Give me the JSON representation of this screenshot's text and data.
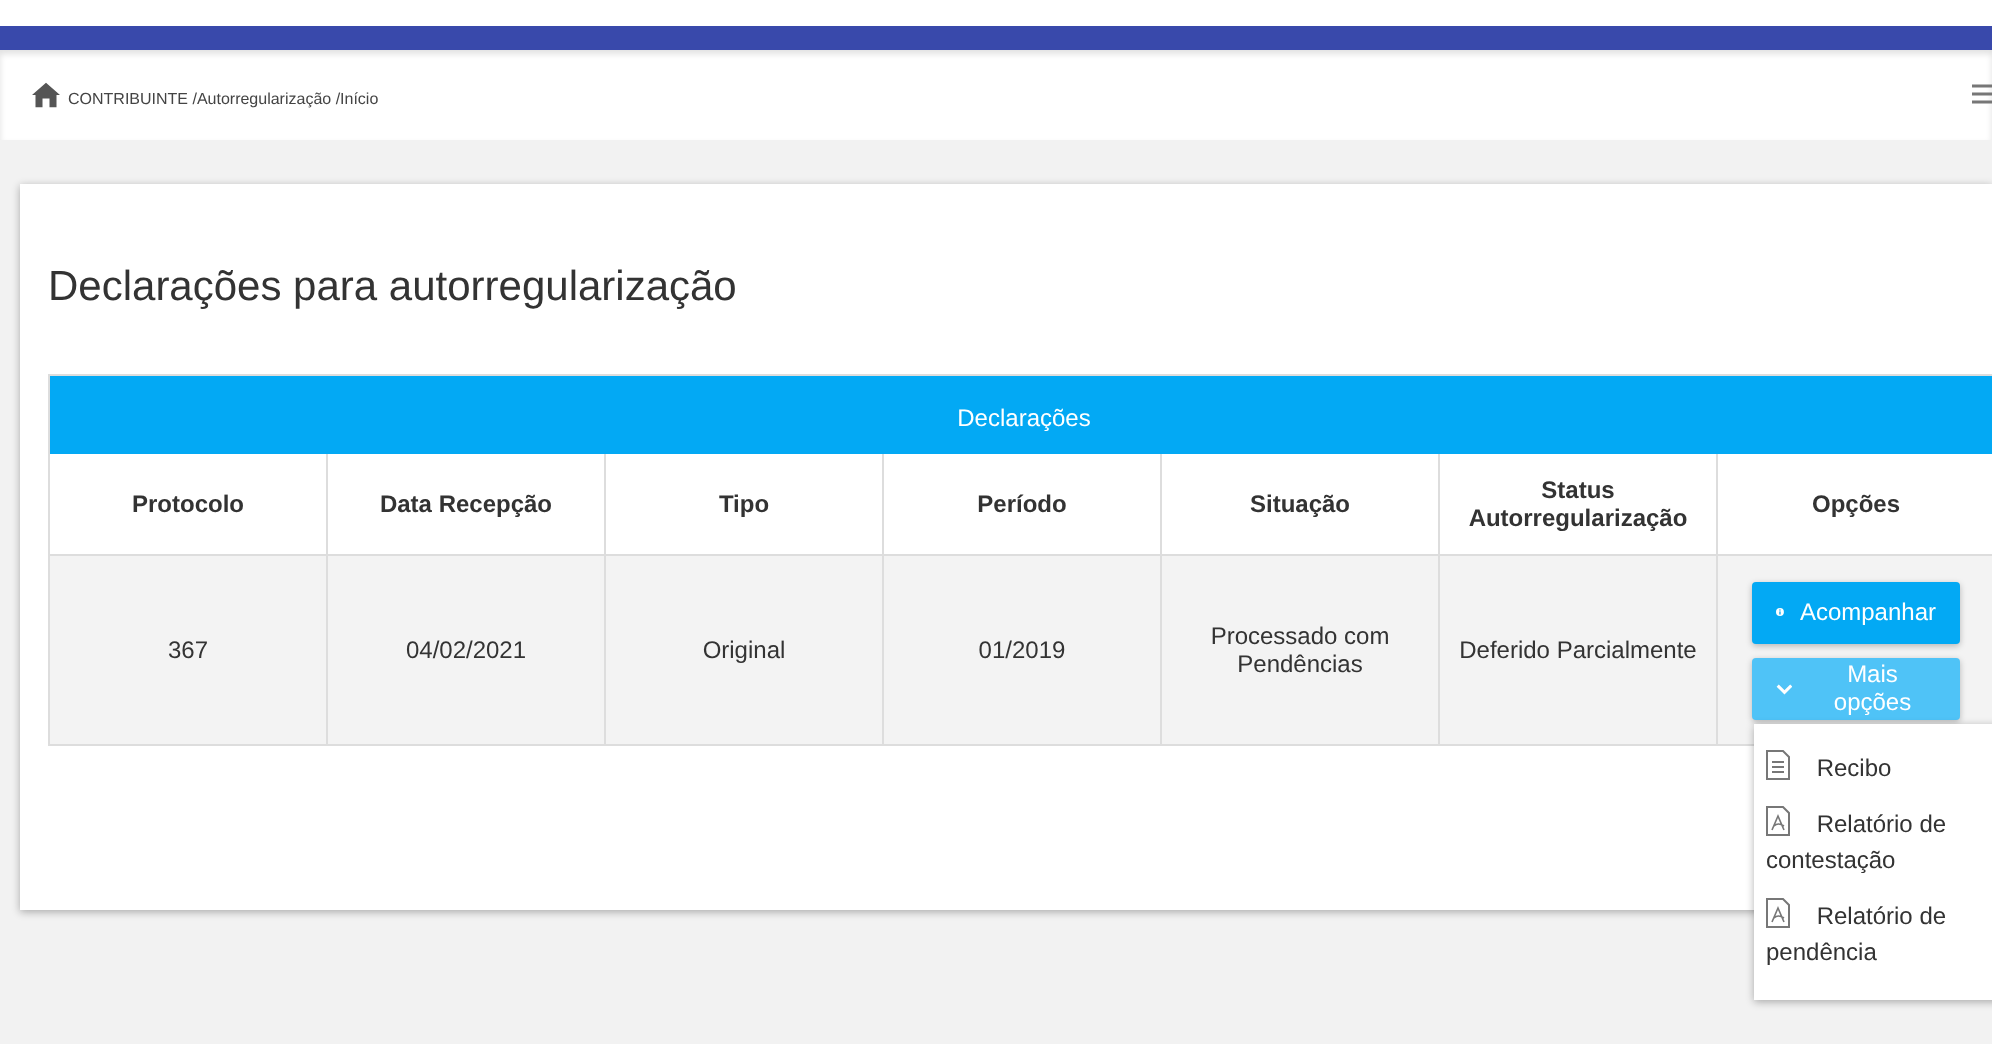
{
  "breadcrumb": "CONTRIBUINTE /Autorregularização /Início",
  "page_title": "Declarações para autorregularização",
  "table": {
    "caption": "Declarações",
    "columns": [
      "Protocolo",
      "Data Recepção",
      "Tipo",
      "Período",
      "Situação",
      "Status Autorregularização",
      "Opções"
    ],
    "rows": [
      {
        "cells": [
          "367",
          "04/02/2021",
          "Original",
          "01/2019",
          "Processado com Pendências",
          "Deferido Parcialmente"
        ],
        "actions": [
          {
            "kind": "info",
            "label": "Acompanhar"
          },
          {
            "kind": "more",
            "label": "Mais opções",
            "expanded": true
          }
        ]
      }
    ]
  },
  "menu": [
    {
      "kind": "doc",
      "label": "Recibo"
    },
    {
      "kind": "pdf",
      "label": "Relatório de contestação"
    },
    {
      "kind": "pdf",
      "label": "Relatório de pendência"
    }
  ]
}
